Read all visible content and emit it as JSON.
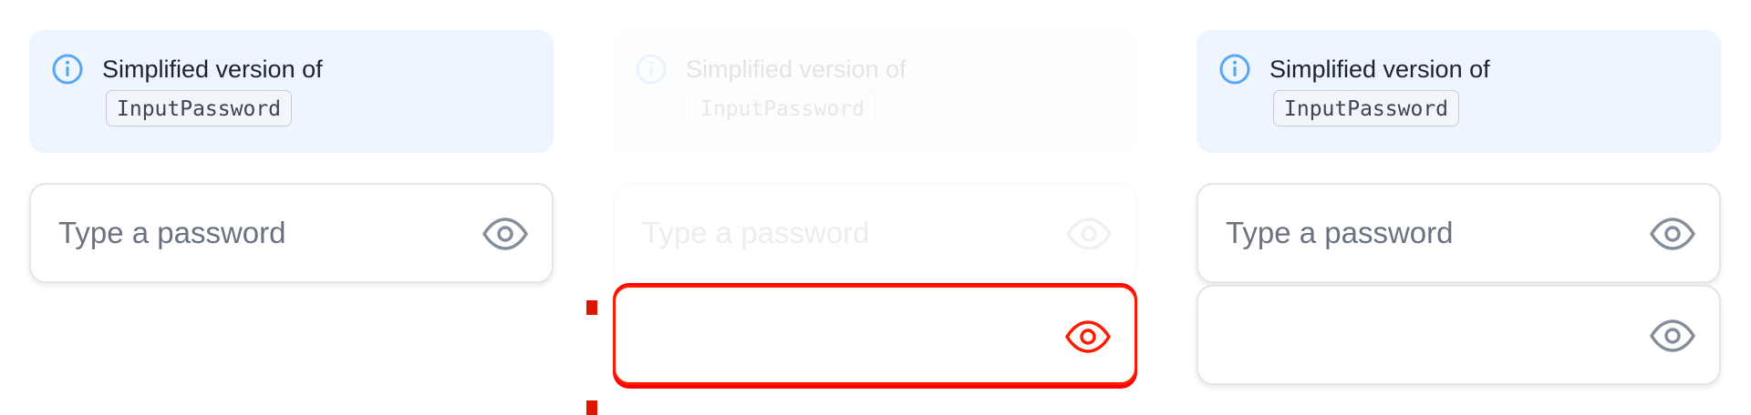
{
  "notice": {
    "text": "Simplified version of",
    "code": "InputPassword"
  },
  "password_field": {
    "placeholder": "Type a password"
  },
  "colors": {
    "info_icon": "#5aa6f0",
    "eye_icon": "#868e9b",
    "error": "#ff1a00"
  },
  "icons": {
    "info": "info-circle-icon",
    "eye": "eye-icon"
  }
}
